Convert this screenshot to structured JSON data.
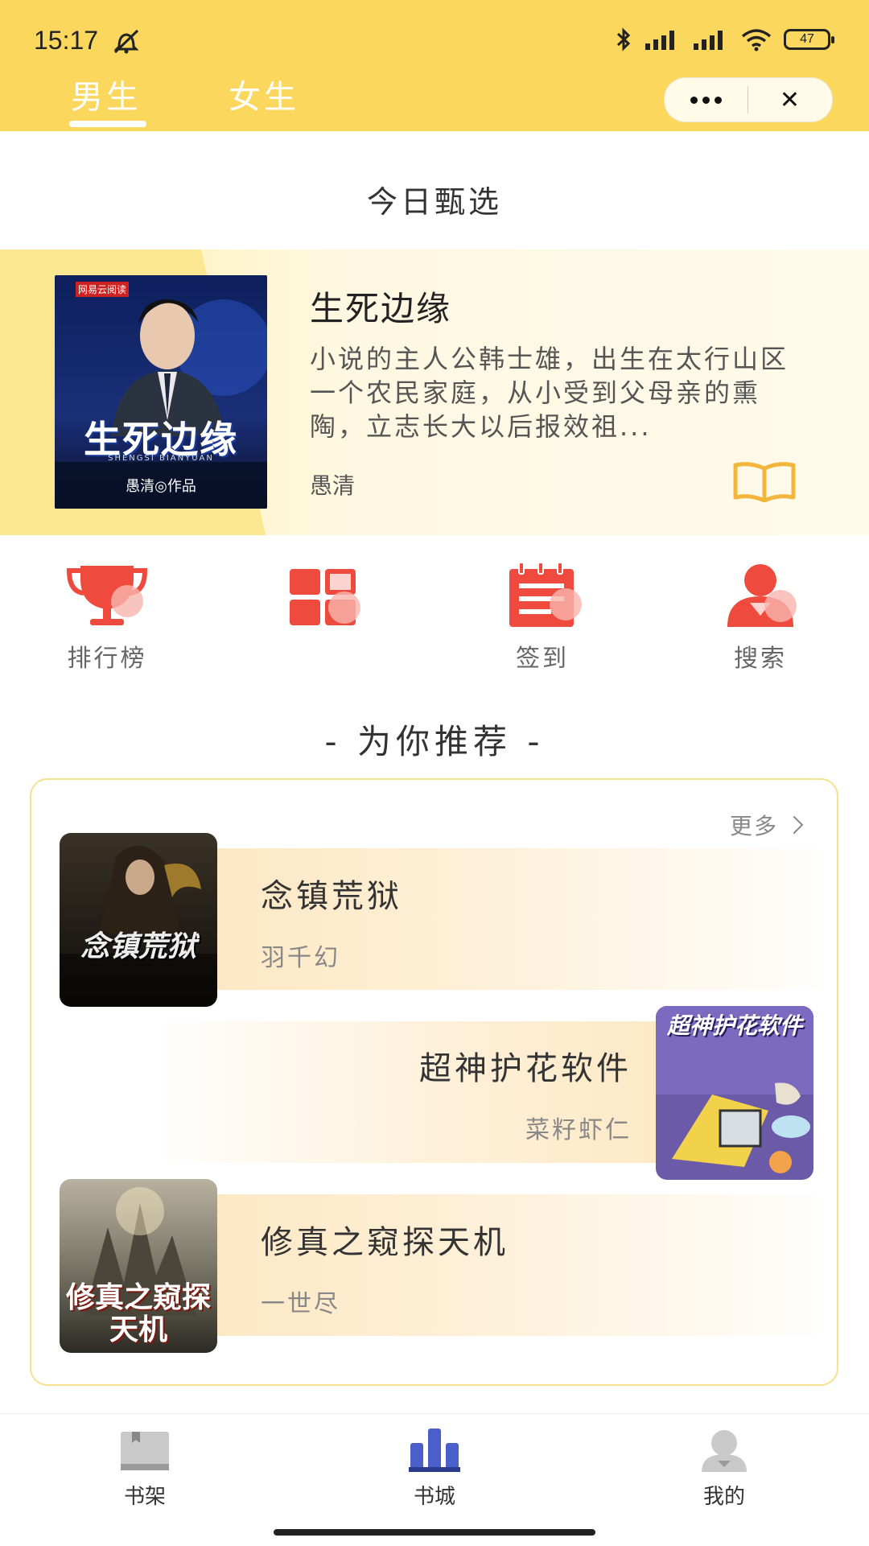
{
  "status_bar": {
    "time": "15:17",
    "battery": "47"
  },
  "header": {
    "tabs": [
      {
        "label": "男生"
      },
      {
        "label": "女生"
      }
    ],
    "capsule": {
      "more_icon": "more-dots-icon",
      "close_label": "✕"
    },
    "colors": {
      "background": "#fbd75e"
    }
  },
  "today_pick": {
    "section_title": "今日甄选",
    "book": {
      "title": "生死边缘",
      "description": "小说的主人公韩士雄，出生在太行山区一个农民家庭，从小受到父母亲的熏陶，立志长大以后报效祖...",
      "author": "愚清",
      "cover_title": "生死边缘",
      "cover_subtitle": "SHENGSI BIANYUAN",
      "cover_author": "愚清◎作品",
      "cover_brand": "网易云阅读"
    }
  },
  "quick_nav": {
    "items": [
      {
        "label": "排行榜",
        "icon": "trophy-icon"
      },
      {
        "label": "",
        "icon": "category-grid-icon"
      },
      {
        "label": "签到",
        "icon": "calendar-icon"
      },
      {
        "label": "搜索",
        "icon": "user-search-icon"
      }
    ],
    "colors": {
      "accent": "#ee4b3e"
    }
  },
  "recommend": {
    "section_title": "- 为你推荐 -",
    "more_label": "更多",
    "books": [
      {
        "title": "念镇荒狱",
        "author": "羽千幻",
        "cover_text": "念镇荒狱"
      },
      {
        "title": "超神护花软件",
        "author": "菜籽虾仁",
        "cover_text": "超神护花软件"
      },
      {
        "title": "修真之窥探天机",
        "author": "一世尽",
        "cover_text": "修真之窥探天机"
      }
    ]
  },
  "bottom_nav": {
    "items": [
      {
        "label": "书架",
        "icon": "bookshelf-icon"
      },
      {
        "label": "书城",
        "icon": "bookstore-icon"
      },
      {
        "label": "我的",
        "icon": "profile-icon"
      }
    ]
  }
}
